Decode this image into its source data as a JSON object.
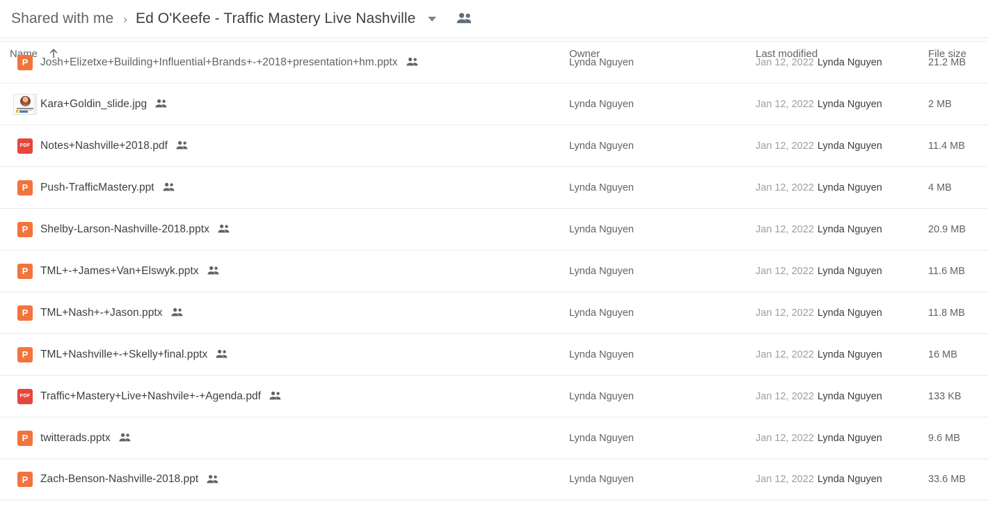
{
  "header": {
    "breadcrumb_root": "Shared with me",
    "breadcrumb_separator": "›",
    "breadcrumb_current": "Ed O'Keefe - Traffic Mastery Live Nashville",
    "dropdown_icon": "chevron-down-icon",
    "people_icon": "people-icon"
  },
  "columns": {
    "name": "Name",
    "sort_icon": "arrow-up-icon",
    "owner": "Owner",
    "last_modified": "Last modified",
    "file_size": "File size"
  },
  "colors": {
    "ppt_icon": "#f3733c",
    "pdf_icon": "#e8453c",
    "row_divider": "#e8eaed",
    "text_primary": "#3c4043",
    "text_secondary": "#5f6368",
    "text_muted": "#9aa0a6"
  },
  "files": [
    {
      "name": "Josh+Elizetxe+Building+Influential+Brands+-+2018+presentation+hm.pptx",
      "icon": "powerpoint-file-icon",
      "type": "ppt",
      "shared": true,
      "owner": "Lynda Nguyen",
      "modified_date": "Jan 12, 2022",
      "modified_by": "Lynda Nguyen",
      "size": "21.2 MB"
    },
    {
      "name": "Kara+Goldin_slide.jpg",
      "icon": "image-thumbnail",
      "type": "image",
      "shared": true,
      "owner": "Lynda Nguyen",
      "modified_date": "Jan 12, 2022",
      "modified_by": "Lynda Nguyen",
      "size": "2 MB"
    },
    {
      "name": "Notes+Nashville+2018.pdf",
      "icon": "pdf-file-icon",
      "type": "pdf",
      "shared": true,
      "owner": "Lynda Nguyen",
      "modified_date": "Jan 12, 2022",
      "modified_by": "Lynda Nguyen",
      "size": "11.4 MB"
    },
    {
      "name": "Push-TrafficMastery.ppt",
      "icon": "powerpoint-file-icon",
      "type": "ppt",
      "shared": true,
      "owner": "Lynda Nguyen",
      "modified_date": "Jan 12, 2022",
      "modified_by": "Lynda Nguyen",
      "size": "4 MB"
    },
    {
      "name": "Shelby-Larson-Nashville-2018.pptx",
      "icon": "powerpoint-file-icon",
      "type": "ppt",
      "shared": true,
      "owner": "Lynda Nguyen",
      "modified_date": "Jan 12, 2022",
      "modified_by": "Lynda Nguyen",
      "size": "20.9 MB"
    },
    {
      "name": "TML+-+James+Van+Elswyk.pptx",
      "icon": "powerpoint-file-icon",
      "type": "ppt",
      "shared": true,
      "owner": "Lynda Nguyen",
      "modified_date": "Jan 12, 2022",
      "modified_by": "Lynda Nguyen",
      "size": "11.6 MB"
    },
    {
      "name": "TML+Nash+-+Jason.pptx",
      "icon": "powerpoint-file-icon",
      "type": "ppt",
      "shared": true,
      "owner": "Lynda Nguyen",
      "modified_date": "Jan 12, 2022",
      "modified_by": "Lynda Nguyen",
      "size": "11.8 MB"
    },
    {
      "name": "TML+Nashville+-+Skelly+final.pptx",
      "icon": "powerpoint-file-icon",
      "type": "ppt",
      "shared": true,
      "owner": "Lynda Nguyen",
      "modified_date": "Jan 12, 2022",
      "modified_by": "Lynda Nguyen",
      "size": "16 MB"
    },
    {
      "name": "Traffic+Mastery+Live+Nashvile+-+Agenda.pdf",
      "icon": "pdf-file-icon",
      "type": "pdf",
      "shared": true,
      "owner": "Lynda Nguyen",
      "modified_date": "Jan 12, 2022",
      "modified_by": "Lynda Nguyen",
      "size": "133 KB"
    },
    {
      "name": "twitterads.pptx",
      "icon": "powerpoint-file-icon",
      "type": "ppt",
      "shared": true,
      "owner": "Lynda Nguyen",
      "modified_date": "Jan 12, 2022",
      "modified_by": "Lynda Nguyen",
      "size": "9.6 MB"
    },
    {
      "name": "Zach-Benson-Nashville-2018.ppt",
      "icon": "powerpoint-file-icon",
      "type": "ppt",
      "shared": true,
      "owner": "Lynda Nguyen",
      "modified_date": "Jan 12, 2022",
      "modified_by": "Lynda Nguyen",
      "size": "33.6 MB"
    }
  ],
  "labels": {
    "pdf_badge": "PDF",
    "ppt_badge": "P"
  }
}
